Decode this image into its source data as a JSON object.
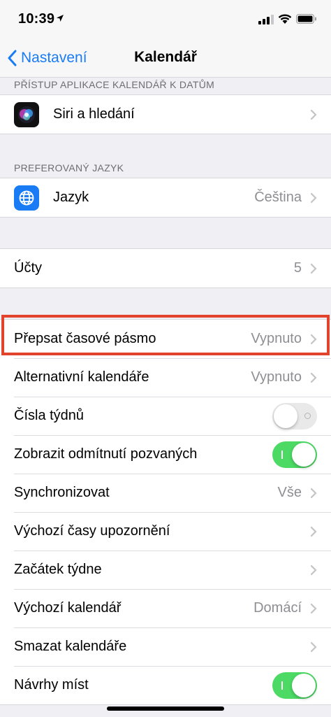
{
  "status_bar": {
    "time": "10:39",
    "icons": [
      "location-arrow-icon",
      "cellular-signal-icon",
      "wifi-icon",
      "battery-icon"
    ]
  },
  "nav": {
    "back_label": "Nastavení",
    "title": "Kalendář"
  },
  "sections": {
    "access_header": "PŘÍSTUP APLIKACE KALENDÁŘ K DATŮM",
    "siri_label": "Siri a hledání",
    "language_header": "PREFEROVANÝ JAZYK",
    "language_label": "Jazyk",
    "language_value": "Čeština",
    "accounts_label": "Účty",
    "accounts_value": "5"
  },
  "settings": [
    {
      "label": "Přepsat časové pásmo",
      "value": "Vypnuto",
      "control": "chevron"
    },
    {
      "label": "Alternativní kalendáře",
      "value": "Vypnuto",
      "control": "chevron"
    },
    {
      "label": "Čísla týdnů",
      "control": "toggle",
      "on": false
    },
    {
      "label": "Zobrazit odmítnutí pozvaných",
      "control": "toggle",
      "on": true
    },
    {
      "label": "Synchronizovat",
      "value": "Vše",
      "control": "chevron"
    },
    {
      "label": "Výchozí časy upozornění",
      "control": "chevron"
    },
    {
      "label": "Začátek týdne",
      "control": "chevron"
    },
    {
      "label": "Výchozí kalendář",
      "value": "Domácí",
      "control": "chevron"
    },
    {
      "label": "Smazat kalendáře",
      "control": "chevron"
    },
    {
      "label": "Návrhy míst",
      "control": "toggle",
      "on": true
    }
  ],
  "colors": {
    "accent": "#1a7cf5",
    "toggle_on": "#4cd964",
    "highlight": "#e2432c",
    "language_icon_bg": "#1a7cf5"
  }
}
